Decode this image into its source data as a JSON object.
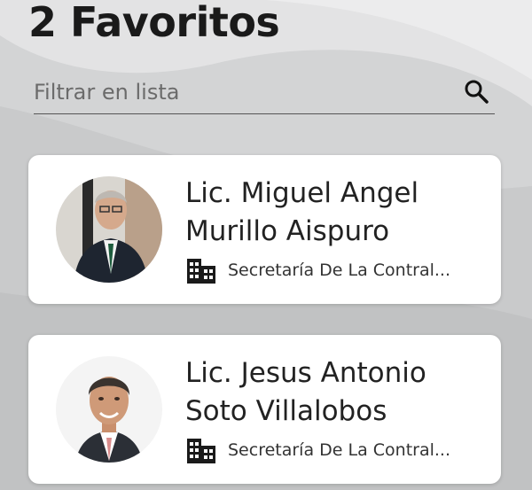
{
  "header": {
    "title": "2 Favoritos"
  },
  "search": {
    "placeholder": "Filtrar en lista",
    "value": "",
    "icon": "search-icon"
  },
  "favorites": [
    {
      "name_line1": "Lic. Miguel Angel",
      "name_line2": "Murillo Aispuro",
      "department": "Secretaría De La Contral...",
      "department_icon": "building-icon"
    },
    {
      "name_line1": "Lic. Jesus Antonio",
      "name_line2": "Soto Villalobos",
      "department": "Secretaría De La Contral...",
      "department_icon": "building-icon"
    }
  ]
}
